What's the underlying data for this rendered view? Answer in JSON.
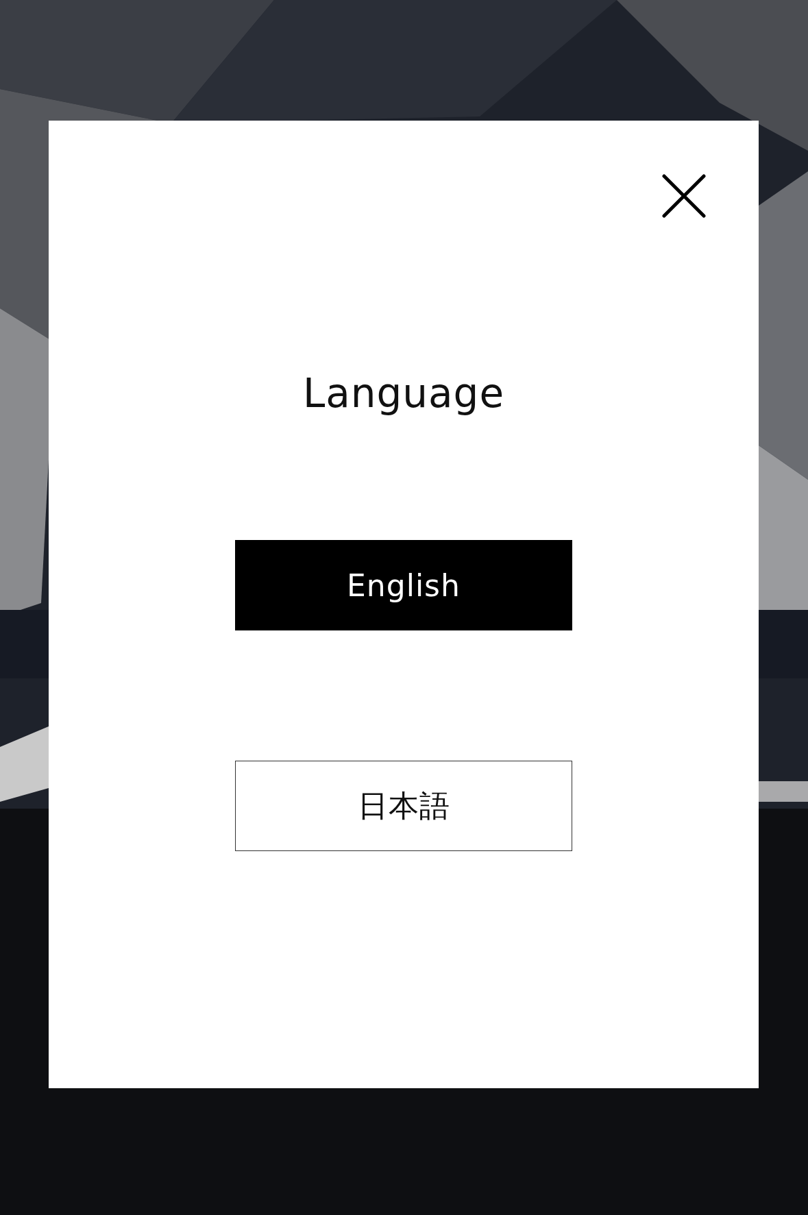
{
  "dialog": {
    "title": "Language",
    "options": [
      {
        "label": "English",
        "selected": true
      },
      {
        "label": "日本語",
        "selected": false
      }
    ]
  }
}
